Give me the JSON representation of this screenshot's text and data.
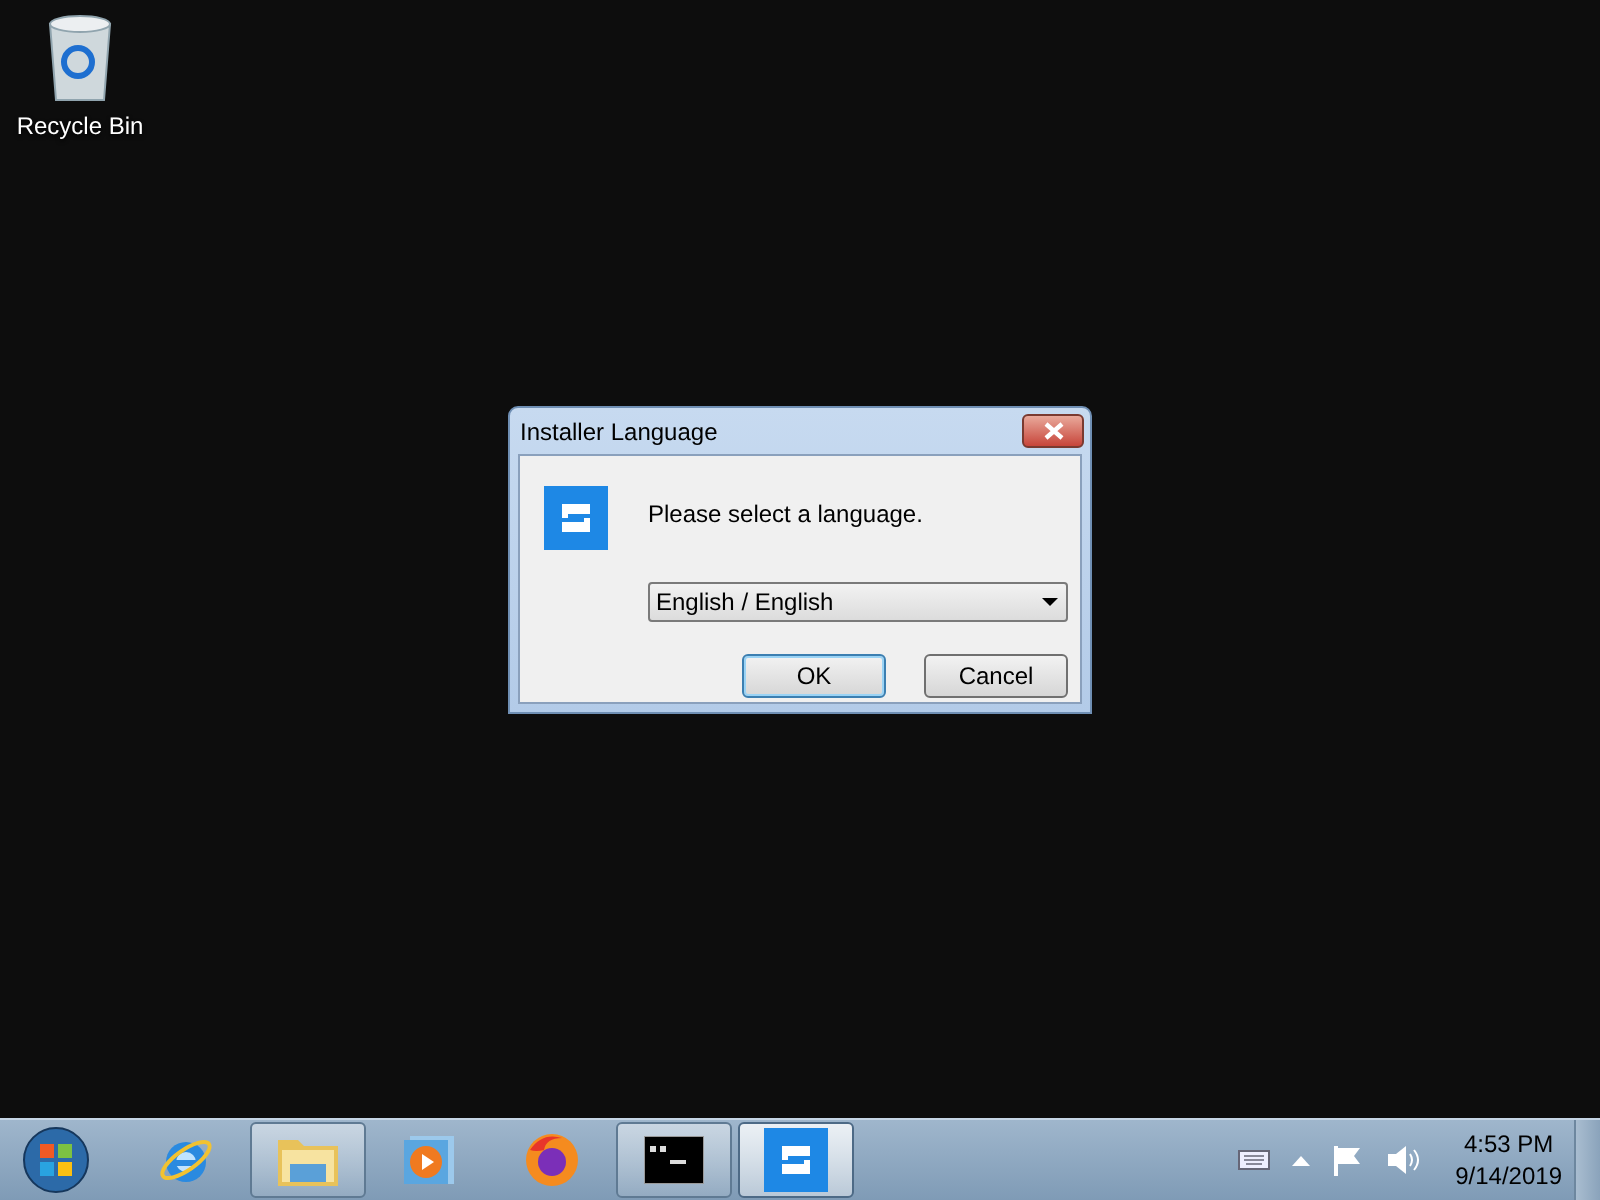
{
  "desktop_icons": [
    {
      "label": "Recycle Bin"
    }
  ],
  "dialog": {
    "title": "Installer Language",
    "message": "Please select a language.",
    "language_select": {
      "value": "English / English"
    },
    "buttons": [
      {
        "label": "OK",
        "default": true
      },
      {
        "label": "Cancel",
        "default": false
      }
    ]
  },
  "taskbar": {
    "items": [
      {
        "kind": "ie",
        "running": false,
        "selected": false
      },
      {
        "kind": "explorer",
        "running": true,
        "selected": false
      },
      {
        "kind": "media",
        "running": false,
        "selected": false
      },
      {
        "kind": "firefox",
        "running": false,
        "selected": false
      },
      {
        "kind": "console",
        "running": true,
        "selected": false
      },
      {
        "kind": "installer",
        "running": true,
        "selected": true
      }
    ],
    "clock": {
      "time": "4:53 PM",
      "date": "9/14/2019"
    }
  }
}
